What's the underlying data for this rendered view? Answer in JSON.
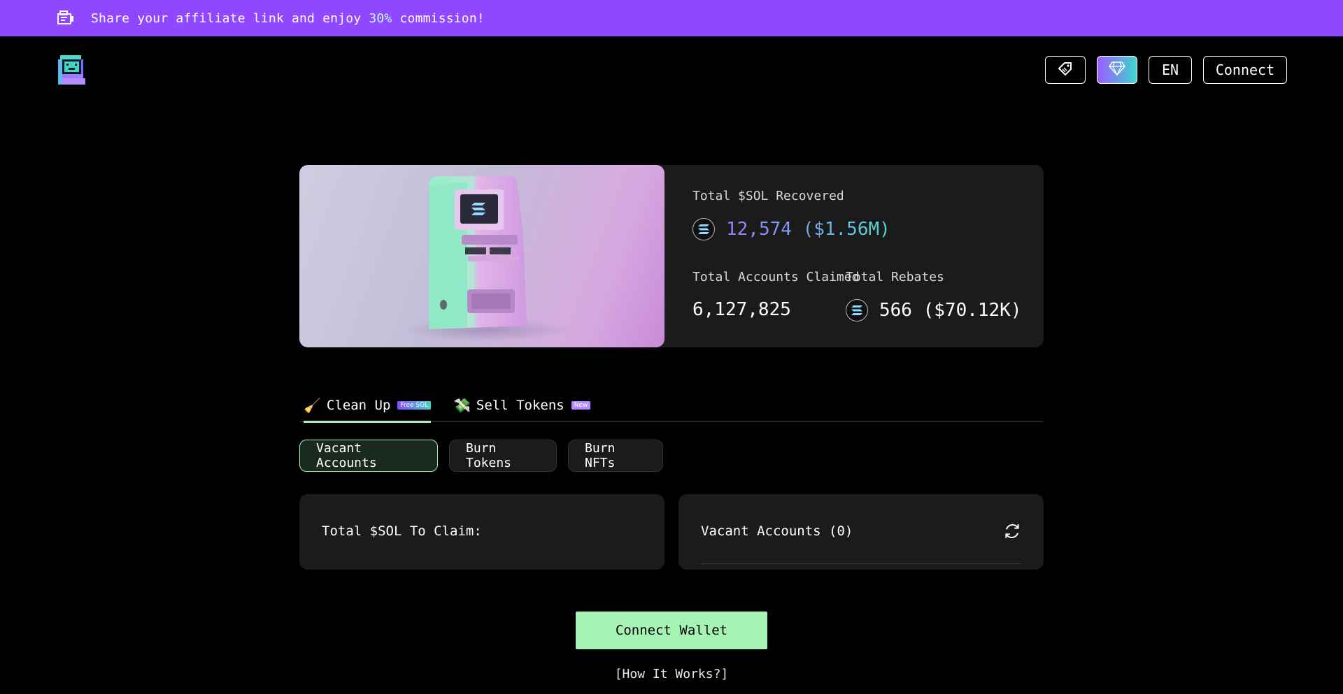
{
  "banner": {
    "text_before": "Share your affiliate link and enjoy ",
    "highlight": "30%",
    "text_after": " commission!",
    "icon": "megaphone-icon",
    "background_color": "#9146ff"
  },
  "header": {
    "logo_icon": "arcade-machine-logo",
    "buttons": {
      "tag_icon": "price-tag-icon",
      "diamond_icon": "diamond-icon",
      "language": "EN",
      "connect": "Connect"
    }
  },
  "stats": {
    "total_sol_recovered_label": "Total $SOL Recovered",
    "total_sol_recovered_value": "12,574 ($1.56M)",
    "total_accounts_claimed_label": "Total Accounts Claimed",
    "total_accounts_claimed_value": "6,127,825",
    "total_rebates_label": "Total Rebates",
    "total_rebates_value": "566 ($70.12K)",
    "coin_icon": "solana-coin-icon"
  },
  "tabs": [
    {
      "emoji": "🧹",
      "label": "Clean Up",
      "badge": "Free SOL",
      "active": true
    },
    {
      "emoji": "💸",
      "label": "Sell Tokens",
      "badge": "New",
      "active": false
    }
  ],
  "subtabs": [
    {
      "label": "Vacant Accounts",
      "active": true
    },
    {
      "label": "Burn Tokens",
      "active": false
    },
    {
      "label": "Burn NFTs",
      "active": false
    }
  ],
  "panels": {
    "claim_label": "Total $SOL To Claim:",
    "vacant_label": "Vacant Accounts (0)"
  },
  "actions": {
    "connect_wallet": "Connect Wallet",
    "how_it_works": "[How It Works?]"
  },
  "colors": {
    "accent_green": "#a6f4b4",
    "accent_purple": "#9146ff",
    "card_bg": "#1b1b1b"
  }
}
